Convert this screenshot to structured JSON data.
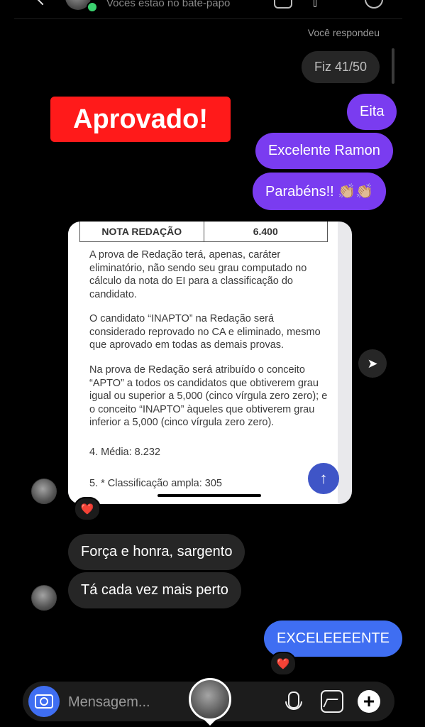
{
  "header": {
    "subtitle": "Vocês estão no bate-papo",
    "replied_label": "Você respondeu"
  },
  "messages": {
    "quoted_reply": "Fiz 41/50",
    "overlay_sticker": "Aprovado!",
    "sent_1": "Eita",
    "sent_2": "Excelente Ramon",
    "sent_3": "Parabéns!! 👏🏼👏🏼",
    "received_1": "Força e honra, sargento",
    "received_2": "Tá cada vez mais perto",
    "sent_4": "EXCELEEEENTE"
  },
  "shared_document": {
    "table": {
      "label": "NOTA REDAÇÃO",
      "value": "6.400"
    },
    "paragraphs": [
      "A prova de Redação terá, apenas, caráter eliminatório, não sendo seu grau computado no cálculo da nota do EI para a classificação do candidato.",
      "O candidato “INAPTO” na Redação será considerado reprovado no CA e eliminado, mesmo que aprovado em todas as demais provas.",
      "Na prova de Redação será atribuído o conceito “APTO” a todos os candidatos que obtiverem grau igual ou superior a 5,000 (cinco vírgula zero zero); e o conceito “INAPTO” àqueles que obtiverem grau inferior a 5,000 (cinco vírgula zero zero).",
      "4. Média: 8.232",
      "5. * Classificação ampla: 305"
    ]
  },
  "reactions": {
    "heart": "❤️"
  },
  "icons": {
    "share": "paper-plane-icon",
    "scroll_up": "arrow-up-icon",
    "camera": "camera-icon",
    "mic": "microphone-icon",
    "gallery": "gallery-icon",
    "add": "plus-icon"
  },
  "composer": {
    "placeholder": "Mensagem..."
  },
  "colors": {
    "background": "#000000",
    "sent_bubble": "#7a3cf0",
    "received_bubble": "#262626",
    "blue_bubble": "#3f6ef2",
    "sticker": "#ff1a1a"
  }
}
